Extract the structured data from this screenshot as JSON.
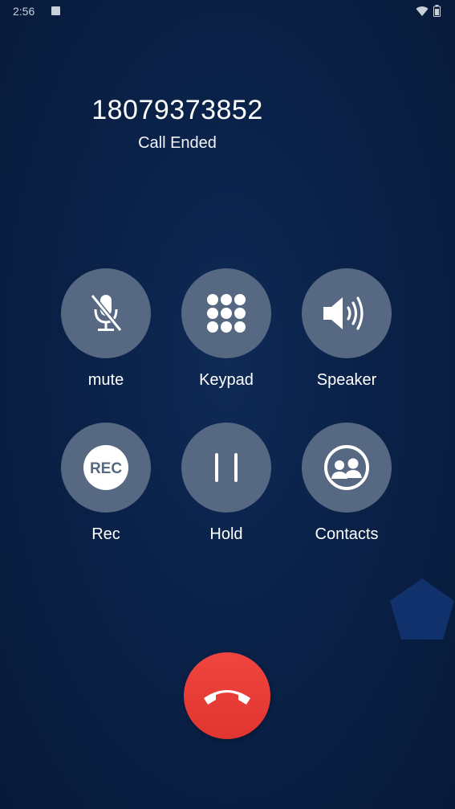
{
  "status_bar": {
    "time": "2:56"
  },
  "caller": {
    "number": "18079373852",
    "status": "Call Ended"
  },
  "actions": {
    "mute": {
      "label": "mute",
      "icon": "mic-off-icon"
    },
    "keypad": {
      "label": "Keypad",
      "icon": "dialpad-icon"
    },
    "speaker": {
      "label": "Speaker",
      "icon": "speaker-icon"
    },
    "rec": {
      "label": "Rec",
      "icon": "rec-icon",
      "icon_text": "REC"
    },
    "hold": {
      "label": "Hold",
      "icon": "pause-icon"
    },
    "contacts": {
      "label": "Contacts",
      "icon": "contacts-icon"
    }
  },
  "end_call": {
    "icon": "phone-hangup-icon"
  },
  "colors": {
    "background": "#0a2148",
    "button": "#566882",
    "end_call": "#e8392f"
  }
}
